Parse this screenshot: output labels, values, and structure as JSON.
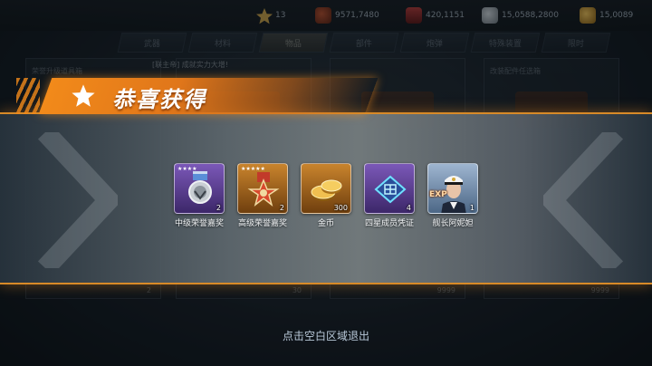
{
  "resources": [
    {
      "icon": "star-icon",
      "value": "13"
    },
    {
      "icon": "supply-sack-icon",
      "value": "9571,7480"
    },
    {
      "icon": "fuel-jar-icon",
      "value": "420,1151"
    },
    {
      "icon": "steel-icon",
      "value": "15,0588,2800"
    },
    {
      "icon": "gold-coin-icon",
      "value": "15,0089"
    }
  ],
  "tabs": [
    "武器",
    "材料",
    "物品",
    "部件",
    "炮弹",
    "特殊装置",
    "限时"
  ],
  "tab_active_index": 2,
  "background": {
    "notice": "[联主帝] 成就实力大增!",
    "cards": [
      {
        "title": "荣誉升级道具箱",
        "count": "2"
      },
      {
        "title": "",
        "count": "30"
      },
      {
        "title": "",
        "count": "9999"
      },
      {
        "title": "改装配件任选箱",
        "count": "9999"
      }
    ]
  },
  "banner": {
    "title": "恭喜获得"
  },
  "rewards": [
    {
      "name": "中级荣誉嘉奖",
      "quantity": "2",
      "stars": "★★★★",
      "icon": "medal-icon",
      "rarity": "purple"
    },
    {
      "name": "高级荣誉嘉奖",
      "quantity": "2",
      "stars": "★★★★★",
      "icon": "star-medal-icon",
      "rarity": "gold"
    },
    {
      "name": "金币",
      "quantity": "300",
      "stars": "",
      "icon": "gold-coins-icon",
      "rarity": "gold"
    },
    {
      "name": "四星成员凭证",
      "quantity": "4",
      "stars": "",
      "icon": "voucher-icon",
      "rarity": "purple"
    },
    {
      "name": "舰长阿妮妲",
      "quantity": "1",
      "stars": "",
      "icon": "captain-portrait-icon",
      "rarity": "blue",
      "tag": "EXP"
    }
  ],
  "exit_hint": "点击空白区域退出",
  "colors": {
    "accent": "#f28a1a",
    "panel_border": "#d88a28"
  }
}
